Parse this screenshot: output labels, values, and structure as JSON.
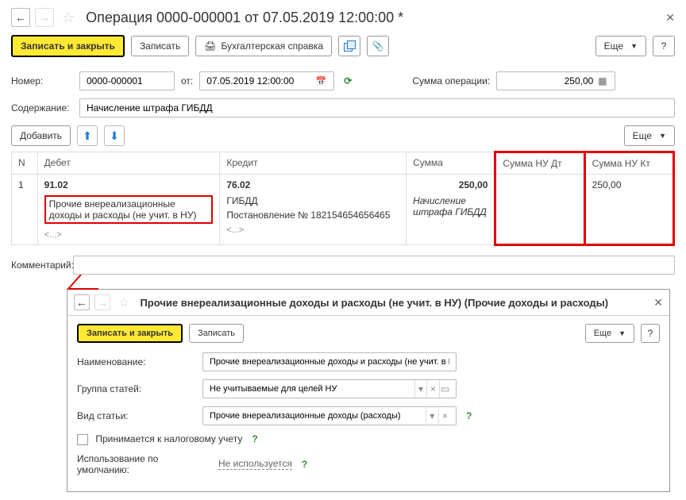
{
  "main": {
    "title": "Операция 0000-000001 от 07.05.2019 12:00:00 *",
    "toolbar": {
      "save_close": "Записать и закрыть",
      "save": "Записать",
      "print_ref": "Бухгалтерская справка",
      "more": "Еще",
      "help": "?"
    },
    "form": {
      "number_label": "Номер:",
      "number_value": "0000-000001",
      "from_label": "от:",
      "date_value": "07.05.2019 12:00:00",
      "sum_label": "Сумма операции:",
      "sum_value": "250,00",
      "content_label": "Содержание:",
      "content_value": "Начисление штрафа ГИБДД"
    },
    "subtoolbar": {
      "add": "Добавить",
      "more": "Еще"
    },
    "grid": {
      "col_n": "N",
      "col_debit": "Дебет",
      "col_credit": "Кредит",
      "col_sum": "Сумма",
      "col_sum_nu_dt": "Сумма НУ Дт",
      "col_sum_nu_kt": "Сумма НУ Кт",
      "row": {
        "n": "1",
        "debit_acc": "91.02",
        "debit_sub": "Прочие внереализационные доходы и расходы (не учит. в НУ)",
        "debit_empty": "<...>",
        "credit_acc": "76.02",
        "credit_sub1": "ГИБДД",
        "credit_sub2": "Постановление № 182154654656465",
        "credit_empty": "<...>",
        "sum": "250,00",
        "sum_note": "Начисление штрафа ГИБДД",
        "sum_nu_dt": "",
        "sum_nu_kt": "250,00"
      }
    },
    "comment_label": "Комментарий:",
    "comment_value": ""
  },
  "sub": {
    "title": "Прочие внереализационные доходы и расходы (не учит. в НУ) (Прочие доходы и расходы)",
    "toolbar": {
      "save_close": "Записать и закрыть",
      "save": "Записать",
      "more": "Еще",
      "help": "?"
    },
    "form": {
      "name_label": "Наименование:",
      "name_value": "Прочие внереализационные доходы и расходы (не учит. в НУ)",
      "group_label": "Группа статей:",
      "group_value": "Не учитываемые для целей НУ",
      "type_label": "Вид статьи:",
      "type_value": "Прочие внереализационные доходы (расходы)",
      "tax_cb_label": "Принимается к налоговому учету",
      "default_label": "Использование по умолчанию:",
      "default_value": "Не используется"
    }
  }
}
